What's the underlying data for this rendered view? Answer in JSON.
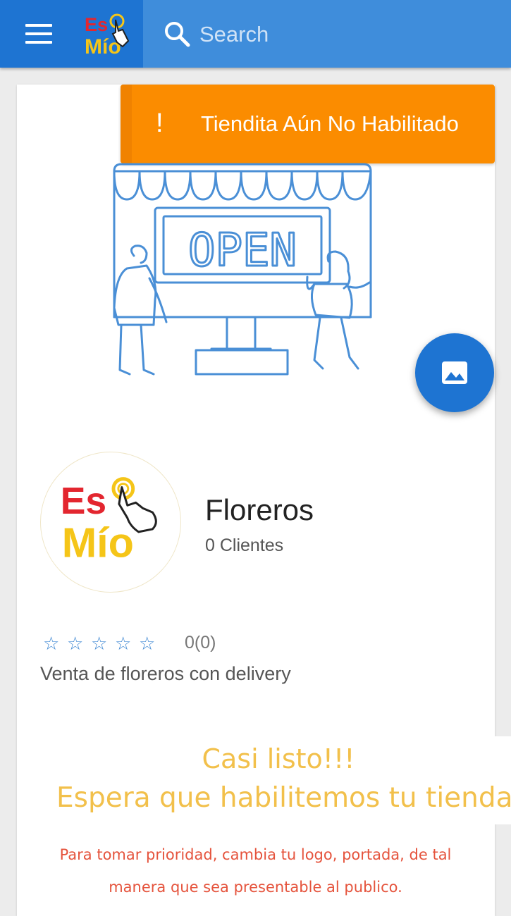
{
  "appbar": {
    "logo_line1": "Es",
    "logo_line2": "Mío",
    "search_placeholder": "Search"
  },
  "banner": {
    "icon": "!",
    "text": "Tiendita Aún No Habilitado"
  },
  "cover": {
    "sign_text": "OPEN"
  },
  "store": {
    "logo_line1": "Es",
    "logo_line2": "Mío",
    "name": "Floreros",
    "clients": "0 Clientes",
    "rating": 0,
    "rating_text": "0(0)",
    "stars": [
      "☆",
      "☆",
      "☆",
      "☆",
      "☆"
    ],
    "description": "Venta de floreros con delivery"
  },
  "notice": {
    "line1": "Casi listo!!!",
    "line2": "Espera que habilitemos tu tienda",
    "hint": "Para tomar prioridad, cambia tu logo, portada, de tal manera que sea presentable al publico."
  },
  "colors": {
    "primary": "#1e74d2",
    "banner": "#fb8c00",
    "notice": "#f2c04b",
    "hint": "#e5533c",
    "logo_red": "#e3262f",
    "logo_yellow": "#f5c518"
  },
  "icons": {
    "menu": "hamburger-menu-icon",
    "search": "search-icon",
    "fab": "image-icon",
    "alert": "exclamation-icon",
    "star": "star-outline-icon"
  }
}
